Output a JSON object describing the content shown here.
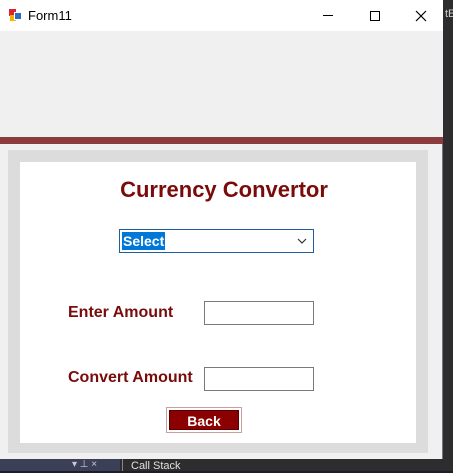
{
  "window": {
    "title": "Form11"
  },
  "form": {
    "heading": "Currency Convertor",
    "currency_select": {
      "selected": "Select"
    },
    "enter_amount_label": "Enter Amount",
    "enter_amount_value": "",
    "convert_amount_label": "Convert Amount",
    "convert_amount_value": "",
    "back_button": "Back"
  },
  "ide": {
    "right_edge_text": "tE",
    "bottom_tab": "Call Stack",
    "bottom_controls": "▾ ⊥ ×"
  },
  "colors": {
    "accent": "#7a0b0b",
    "band": "#8c3c3c",
    "button": "#8b0000",
    "selection": "#0078d7"
  }
}
